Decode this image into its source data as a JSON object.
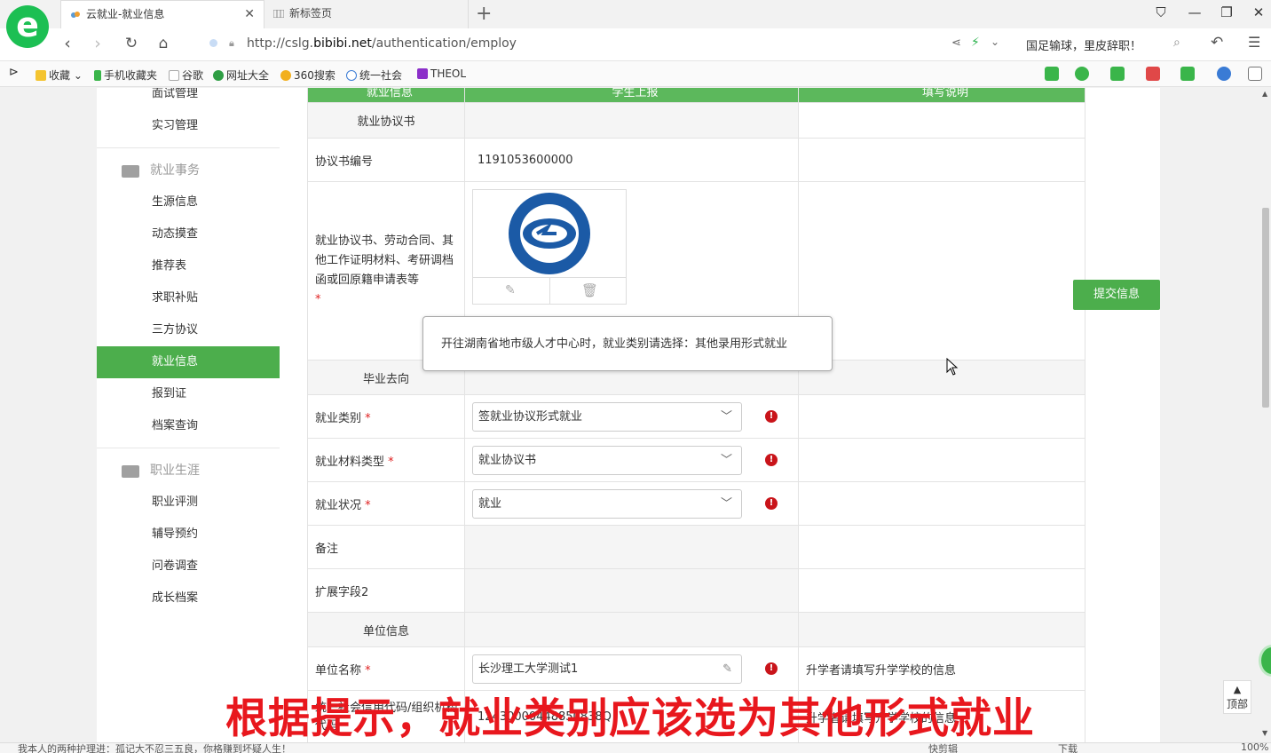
{
  "browser": {
    "tabs": [
      {
        "label": "云就业-就业信息",
        "active": true
      },
      {
        "label": "新标签页",
        "active": false
      }
    ],
    "url_prefix": "http://cslg.",
    "url_domain": "bibibi.net",
    "url_path": "/authentication/employ",
    "news_ticker": "国足输球，里皮辞职！",
    "logo_letter": "e",
    "bookmarks": [
      "收藏",
      "手机收藏夹",
      "谷歌",
      "网址大全",
      "360搜索",
      "统一社会",
      "THEOL"
    ]
  },
  "sidebar": {
    "top_items": [
      "面试管理",
      "实习管理"
    ],
    "group1": {
      "title": "就业事务",
      "items": [
        "生源信息",
        "动态摸查",
        "推荐表",
        "求职补贴",
        "三方协议",
        "就业信息",
        "报到证",
        "档案查询"
      ],
      "active_index": 5
    },
    "group2": {
      "title": "职业生涯",
      "items": [
        "职业评测",
        "辅导预约",
        "问卷调查",
        "成长档案"
      ]
    }
  },
  "form": {
    "header_cols": [
      "就业信息",
      "学生上报",
      "填写说明"
    ],
    "section_agreement": "就业协议书",
    "agreement_number_label": "协议书编号",
    "agreement_number_value": "1191053600000",
    "attachments_label": "就业协议书、劳动合同、其他工作证明材料、考研调档函或回原籍申请表等",
    "required_mark": "*",
    "section_destination": "毕业去向",
    "employment_type_label": "就业类别",
    "employment_type_value": "签就业协议形式就业",
    "material_type_label": "就业材料类型",
    "material_type_value": "就业协议书",
    "status_label": "就业状况",
    "status_value": "就业",
    "remark_label": "备注",
    "ext_field_label": "扩展字段2",
    "section_unit": "单位信息",
    "unit_name_label": "单位名称",
    "unit_name_value": "长沙理工大学测试1",
    "unit_name_hint": "升学者请填写升学学校的信息",
    "credit_code_label": "统一社会信用代码/组织机构代码",
    "credit_code_value": "12430000448850838Q",
    "credit_code_hint": "升学者请填写升学学校的信息"
  },
  "tooltip": "开往湖南省地市级人才中心时，就业类别请选择：其他录用形式就业",
  "submit_label": "提交信息",
  "to_top_label": "顶部",
  "subtitle": "根据提示，就业类别应该选为其他形式就业",
  "status_bar": {
    "left_text": "我本人的两种护理进：孤记大不忍三五良，你格赚到坏疑人生！",
    "shortcut": "快剪辑",
    "download": "下载",
    "zoom": "100%"
  },
  "colors": {
    "accent_green": "#4cae4c",
    "error_red": "#c9141a",
    "subtitle_red": "#e8171d"
  }
}
